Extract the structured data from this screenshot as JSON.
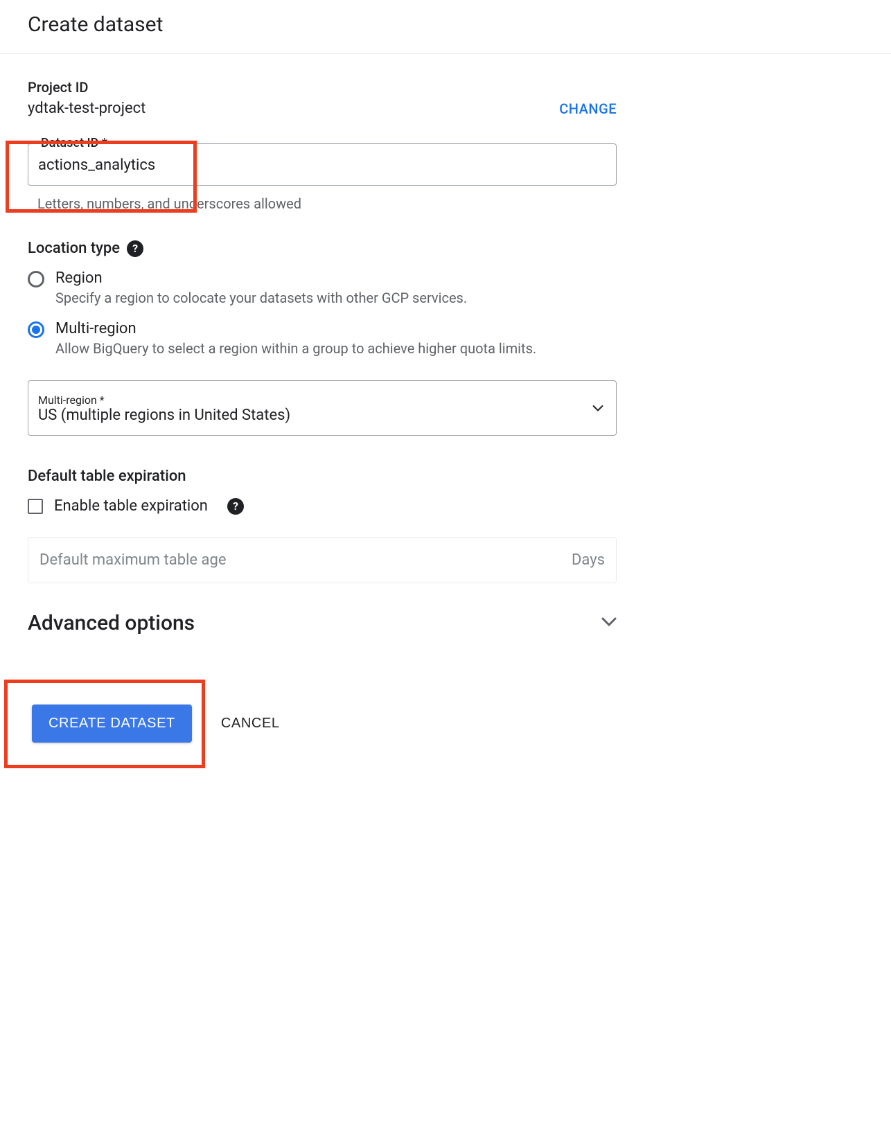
{
  "header": {
    "title": "Create dataset"
  },
  "project": {
    "label": "Project ID",
    "value": "ydtak-test-project",
    "change_label": "CHANGE"
  },
  "dataset_id": {
    "label": "Dataset ID *",
    "value": "actions_analytics",
    "helper": "Letters, numbers, and underscores allowed"
  },
  "location": {
    "section_title": "Location type",
    "options": [
      {
        "label": "Region",
        "description": "Specify a region to colocate your datasets with other GCP services.",
        "selected": false
      },
      {
        "label": "Multi-region",
        "description": "Allow BigQuery to select a region within a group to achieve higher quota limits.",
        "selected": true
      }
    ],
    "multi_region_field": {
      "label": "Multi-region *",
      "value": "US (multiple regions in United States)"
    }
  },
  "expiration": {
    "section_title": "Default table expiration",
    "checkbox_label": "Enable table expiration",
    "max_age_placeholder": "Default maximum table age",
    "max_age_unit": "Days"
  },
  "advanced": {
    "title": "Advanced options"
  },
  "actions": {
    "primary": "CREATE DATASET",
    "cancel": "CANCEL"
  }
}
